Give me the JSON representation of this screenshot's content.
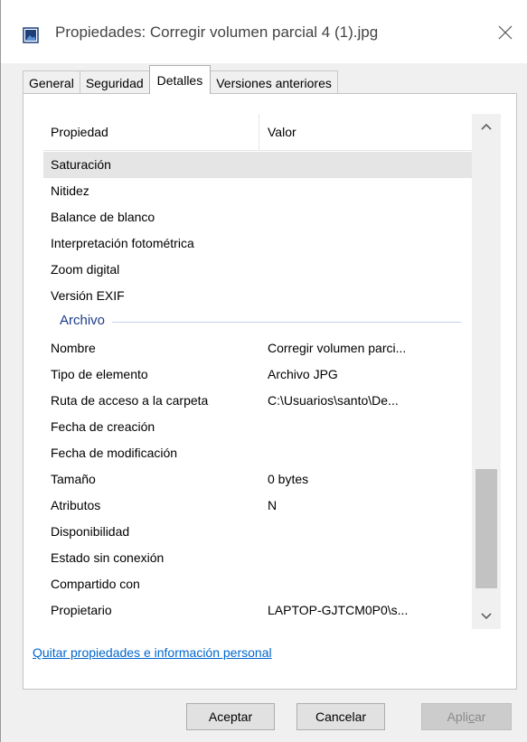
{
  "window": {
    "title": "Propiedades: Corregir volumen parcial 4 (1).jpg",
    "close_glyph": "✕"
  },
  "tabs": [
    {
      "label": "General",
      "active": false
    },
    {
      "label": "Seguridad",
      "active": false
    },
    {
      "label": "Detalles",
      "active": true
    },
    {
      "label": "Versiones anteriores",
      "active": false
    }
  ],
  "table": {
    "header": {
      "property": "Propiedad",
      "value": "Valor"
    },
    "image_rows": [
      {
        "name": "Saturación",
        "value": ""
      },
      {
        "name": "Nitidez",
        "value": ""
      },
      {
        "name": "Balance de blanco",
        "value": ""
      },
      {
        "name": "Interpretación fotométrica",
        "value": ""
      },
      {
        "name": "Zoom digital",
        "value": ""
      },
      {
        "name": "Versión EXIF",
        "value": ""
      }
    ],
    "group_label": "Archivo",
    "file_rows": [
      {
        "name": "Nombre",
        "value": "Corregir volumen parci..."
      },
      {
        "name": "Tipo de elemento",
        "value": "Archivo JPG"
      },
      {
        "name": "Ruta de acceso a la carpeta",
        "value": "C:\\Usuarios\\santo\\De..."
      },
      {
        "name": "Fecha de creación",
        "value": ""
      },
      {
        "name": "Fecha de modificación",
        "value": ""
      },
      {
        "name": "Tamaño",
        "value": "0 bytes"
      },
      {
        "name": "Atributos",
        "value": "N"
      },
      {
        "name": "Disponibilidad",
        "value": ""
      },
      {
        "name": "Estado sin conexión",
        "value": ""
      },
      {
        "name": "Compartido con",
        "value": ""
      },
      {
        "name": "Propietario",
        "value": "LAPTOP-GJTCM0P0\\s..."
      }
    ]
  },
  "remove_link": "Quitar propiedades e información personal",
  "buttons": {
    "ok": "Aceptar",
    "cancel": "Cancelar",
    "apply_prefix": "Apli",
    "apply_mnemonic": "c",
    "apply_suffix": "ar"
  },
  "colors": {
    "accent_link": "#0066cc",
    "group_label": "#1e3c8c"
  }
}
